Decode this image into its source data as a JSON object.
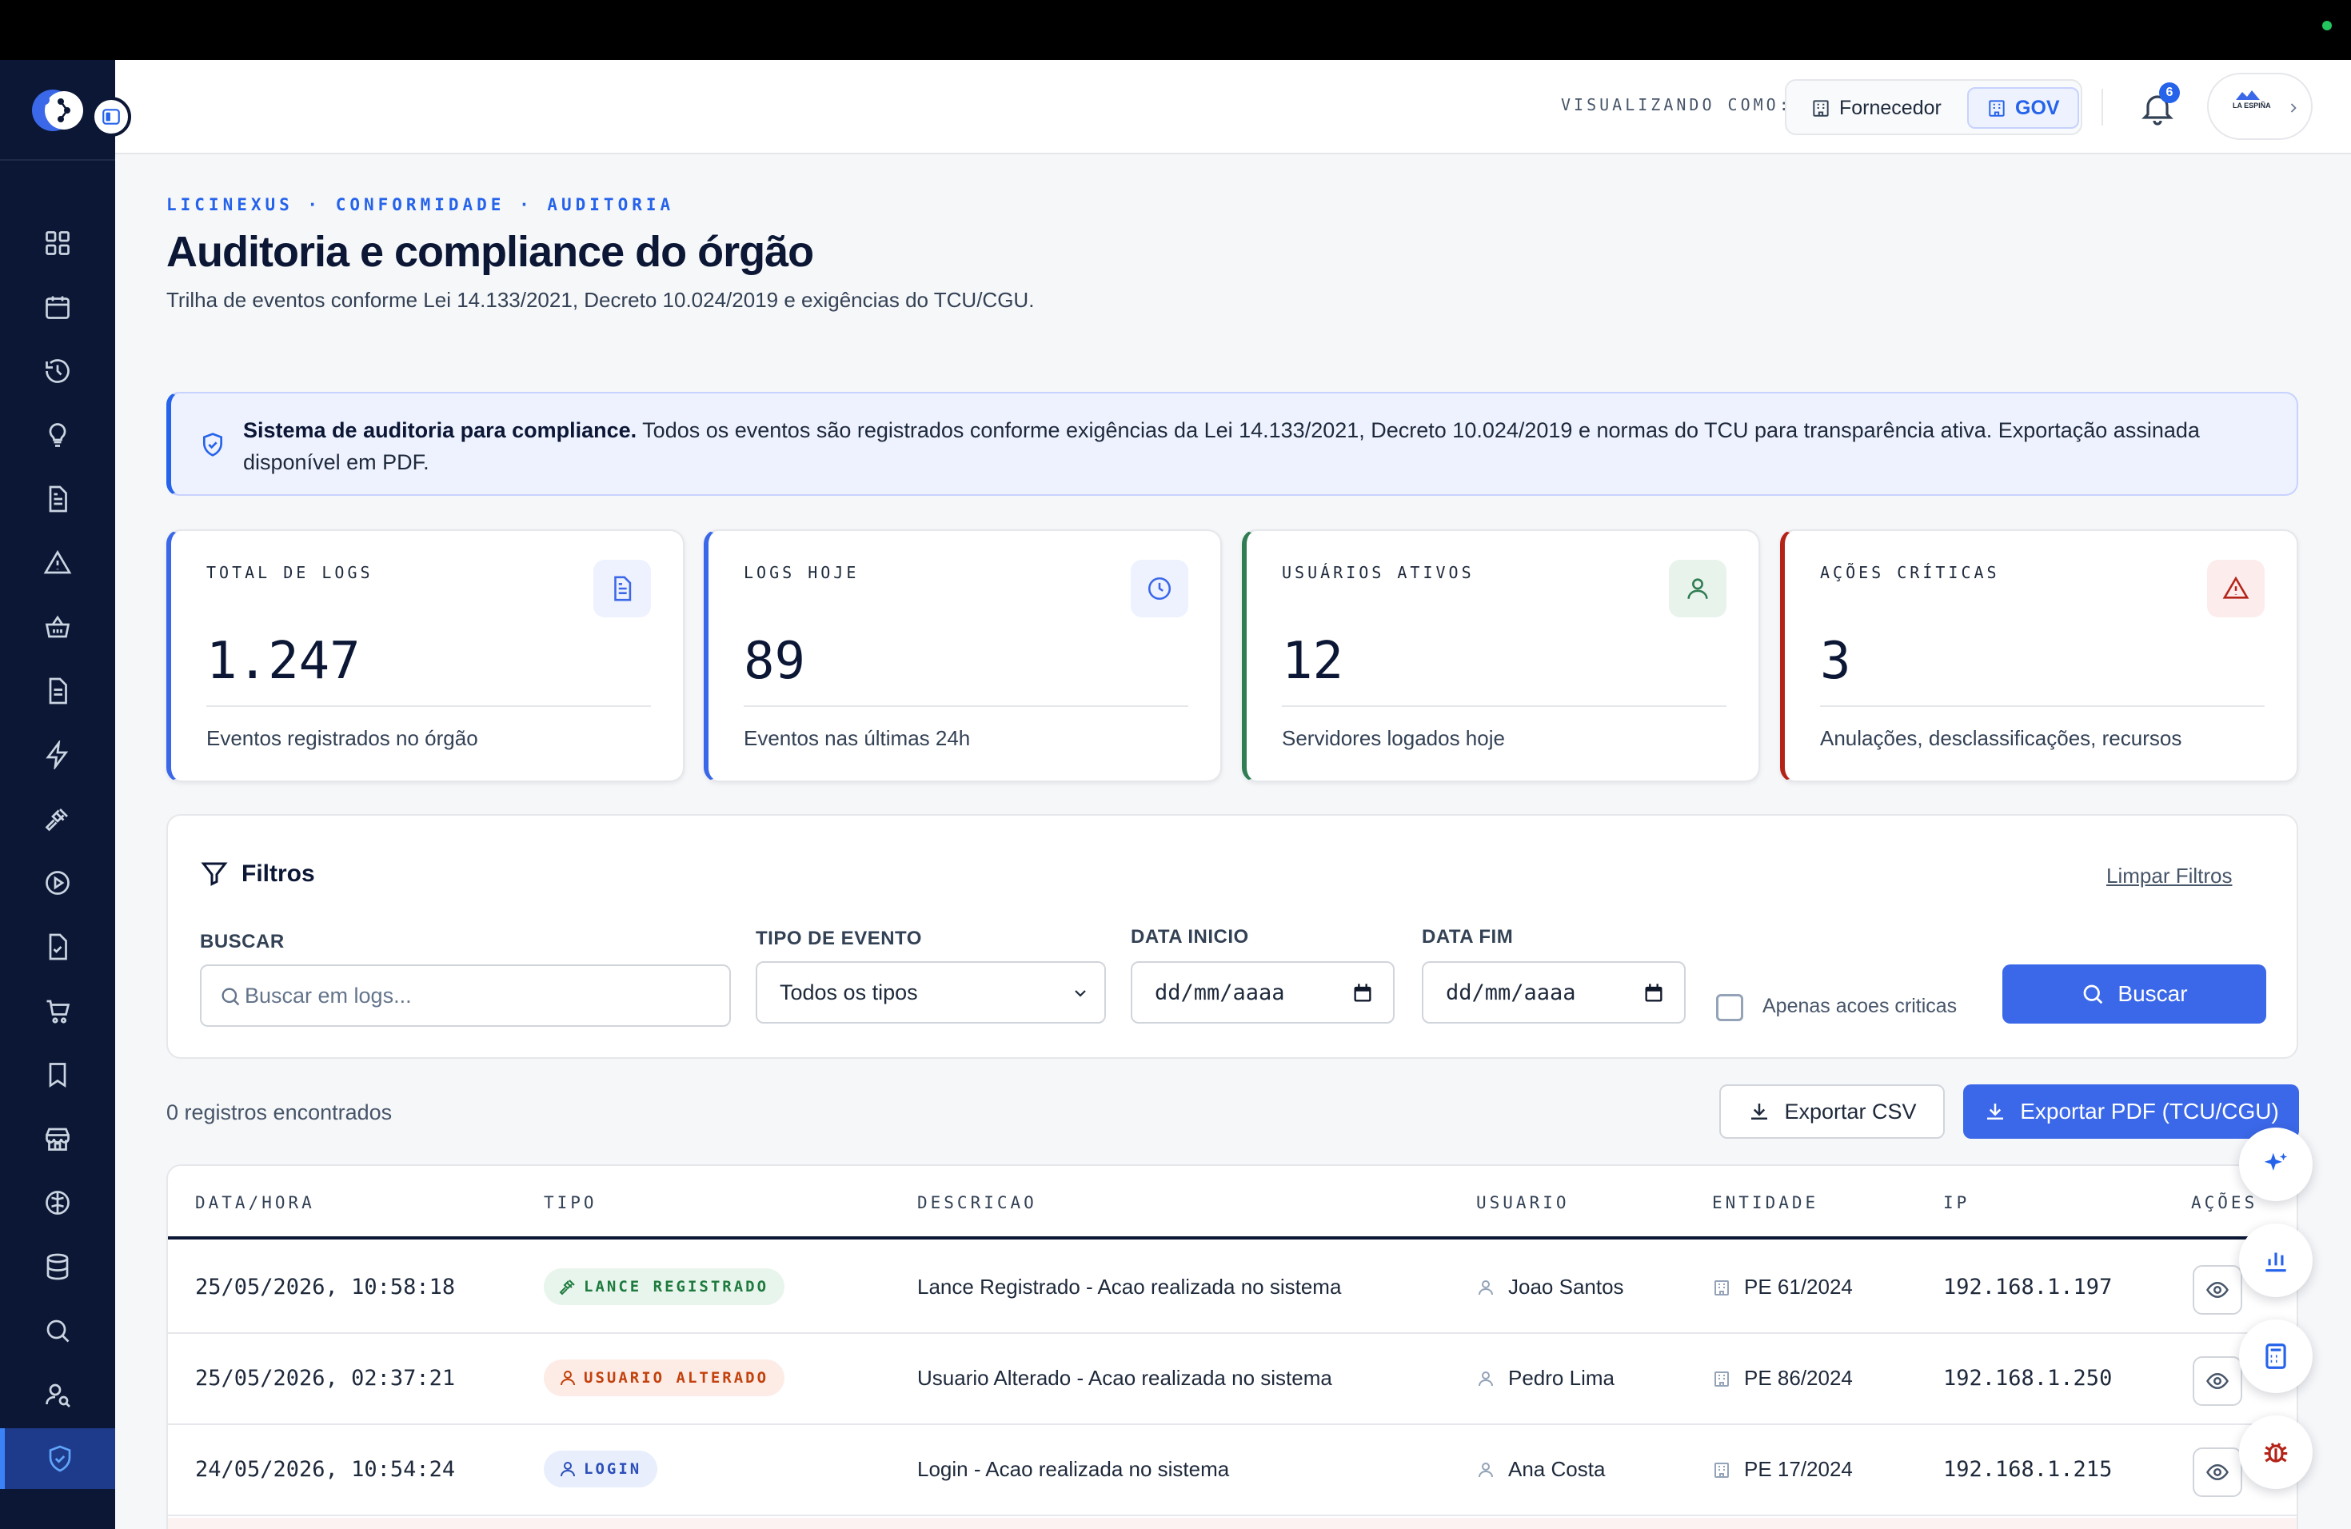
{
  "header": {
    "viewing_label": "VISUALIZANDO COMO:",
    "roles": {
      "fornecedor": "Fornecedor",
      "gov": "GOV"
    },
    "active_role": "GOV",
    "notification_count": "6",
    "account_logo_text": "LA ESPIÑA"
  },
  "page": {
    "breadcrumb": "LICINEXUS · CONFORMIDADE · AUDITORIA",
    "title": "Auditoria e compliance do órgão",
    "subtitle": "Trilha de eventos conforme Lei 14.133/2021, Decreto 10.024/2019 e exigências do TCU/CGU."
  },
  "notice": {
    "bold": "Sistema de auditoria para compliance.",
    "text": " Todos os eventos são registrados conforme exigências da Lei 14.133/2021, Decreto 10.024/2019 e normas do TCU para transparência ativa. Exportação assinada disponível em PDF."
  },
  "stats": [
    {
      "label": "TOTAL DE LOGS",
      "value": "1.247",
      "desc": "Eventos registrados no órgão",
      "icon": "document-icon",
      "accent": "#3b68e8"
    },
    {
      "label": "LOGS HOJE",
      "value": "89",
      "desc": "Eventos nas últimas 24h",
      "icon": "clock-icon",
      "accent": "#3b68e8"
    },
    {
      "label": "USUÁRIOS ATIVOS",
      "value": "12",
      "desc": "Servidores logados hoje",
      "icon": "user-icon",
      "accent": "#2f7d52"
    },
    {
      "label": "AÇÕES CRÍTICAS",
      "value": "3",
      "desc": "Anulações, desclassificações, recursos",
      "icon": "warning-icon",
      "accent": "#b42318"
    }
  ],
  "filters": {
    "title": "Filtros",
    "clear": "Limpar Filtros",
    "search_label": "BUSCAR",
    "search_placeholder": "Buscar em logs...",
    "type_label": "TIPO DE EVENTO",
    "type_value": "Todos os tipos",
    "start_label": "DATA INICIO",
    "start_value": "dd/mm/aaaa",
    "end_label": "DATA FIM",
    "end_value": "dd/mm/aaaa",
    "critical_label": "Apenas acoes criticas",
    "search_button": "Buscar"
  },
  "results": {
    "count": "0 registros encontrados",
    "export_csv": "Exportar CSV",
    "export_pdf": "Exportar PDF (TCU/CGU)"
  },
  "table": {
    "columns": [
      "DATA/HORA",
      "TIPO",
      "DESCRICAO",
      "USUARIO",
      "ENTIDADE",
      "IP",
      "AÇÕES"
    ],
    "rows": [
      {
        "datetime": "25/05/2026, 10:58:18",
        "type": "LANCE REGISTRADO",
        "description": "Lance Registrado - Acao realizada no sistema",
        "user": "Joao Santos",
        "entity": "PE 61/2024",
        "ip": "192.168.1.197"
      },
      {
        "datetime": "25/05/2026, 02:37:21",
        "type": "USUARIO ALTERADO",
        "description": "Usuario Alterado - Acao realizada no sistema",
        "user": "Pedro Lima",
        "entity": "PE 86/2024",
        "ip": "192.168.1.250"
      },
      {
        "datetime": "24/05/2026, 10:54:24",
        "type": "LOGIN",
        "description": "Login - Acao realizada no sistema",
        "user": "Ana Costa",
        "entity": "PE 17/2024",
        "ip": "192.168.1.215"
      }
    ]
  },
  "colors": {
    "sidebar": "#0b1735",
    "primary": "#3b68e8",
    "badge_green": "#1f7a3f",
    "badge_orange": "#c2410c",
    "badge_blue": "#2c4fb8"
  }
}
